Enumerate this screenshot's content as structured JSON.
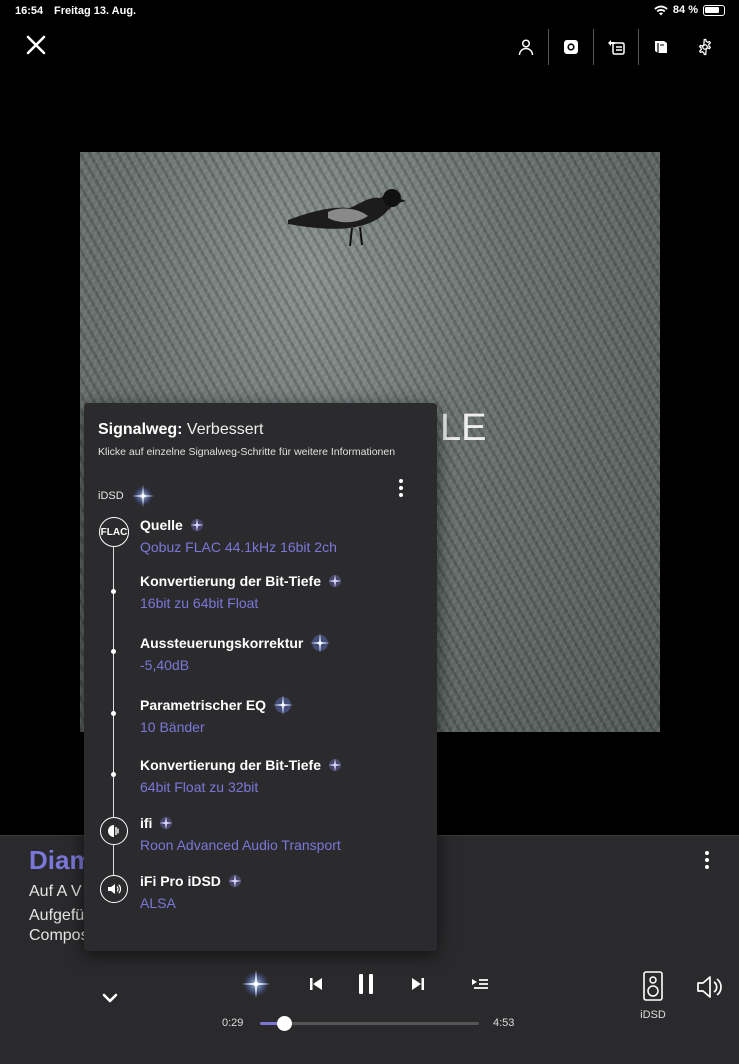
{
  "status": {
    "time": "16:54",
    "date": "Freitag 13. Aug.",
    "battery": "84 %"
  },
  "toolbar": {
    "icons": [
      "person-icon",
      "radio-icon",
      "queue-icon",
      "book-icon",
      "gear-icon"
    ]
  },
  "album": {
    "visible_letters": "LE"
  },
  "track": {
    "title": "Diam",
    "line1": "Auf A V",
    "line2": "Aufgefü",
    "line3": "Compos"
  },
  "player": {
    "time_current": "0:29",
    "time_total": "4:53",
    "progress": 0.11,
    "zone": "iDSD"
  },
  "signal_path": {
    "label": "Signalweg:",
    "quality": "Verbessert",
    "subtitle": "Klicke auf einzelne Signalweg-Schritte für weitere Informationen",
    "zone": "iDSD",
    "source_badge": "FLAC",
    "steps": [
      {
        "name": "Quelle",
        "value": "Qobuz FLAC 44.1kHz 16bit 2ch"
      },
      {
        "name": "Konvertierung der Bit-Tiefe",
        "value": "16bit zu 64bit Float"
      },
      {
        "name": "Aussteuerungskorrektur",
        "value": "-5,40dB"
      },
      {
        "name": "Parametrischer EQ",
        "value": "10 Bänder"
      },
      {
        "name": "Konvertierung der Bit-Tiefe",
        "value": "64bit Float zu 32bit"
      },
      {
        "name": "ifi",
        "value": "Roon Advanced Audio Transport"
      },
      {
        "name": "iFi Pro iDSD",
        "value": "ALSA"
      }
    ]
  },
  "colors": {
    "accent": "#7b77d9",
    "panel": "#2b2b2d",
    "bar": "#2a2a2c"
  }
}
